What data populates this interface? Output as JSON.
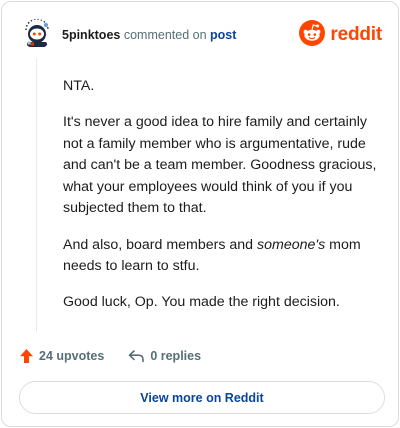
{
  "header": {
    "username": "5pinktoes",
    "action": "commented on",
    "post_link": "post",
    "brand": "reddit"
  },
  "comment": {
    "paragraphs": [
      {
        "text": "NTA."
      },
      {
        "text": "It's never a good idea to hire family and certainly not a family member who is argumentative, rude and can't be a team member. Goodness gracious, what your employees would think of you if you subjected them to that."
      },
      {
        "before": "And also, board members and ",
        "emph": "someone's",
        "after": " mom needs to learn to stfu."
      },
      {
        "text": "Good luck, Op. You made the right decision."
      }
    ]
  },
  "footer": {
    "upvotes": "24 upvotes",
    "replies": "0 replies",
    "view_button": "View more on Reddit"
  },
  "colors": {
    "brand": "#ff4500",
    "link": "#0a449b",
    "muted": "#576f76"
  },
  "icons": {
    "avatar": "snoo-avatar-icon",
    "logo": "reddit-logo-icon",
    "upvote": "upvote-arrow-icon",
    "reply": "reply-arrow-icon"
  }
}
